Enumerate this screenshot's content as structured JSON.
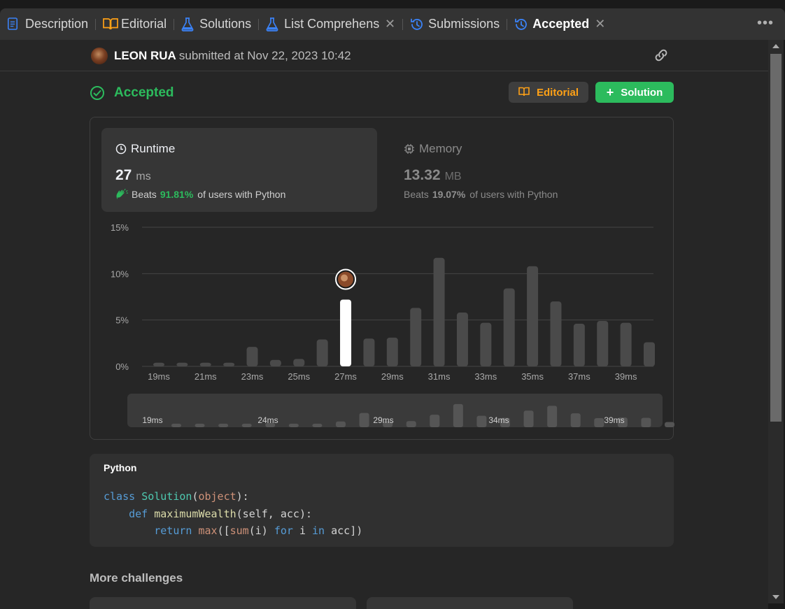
{
  "tabs": [
    {
      "label": "Description",
      "icon": "description-icon",
      "color": "#3b82f6",
      "active": false
    },
    {
      "label": "Editorial",
      "icon": "book-icon",
      "color": "#ffa116",
      "active": false
    },
    {
      "label": "Solutions",
      "icon": "flask-icon",
      "color": "#3b82f6",
      "active": false
    },
    {
      "label": "List Comprehension",
      "icon": "flask-icon",
      "color": "#3b82f6",
      "active": false,
      "closable": true
    },
    {
      "label": "Submissions",
      "icon": "history-icon",
      "color": "#3b82f6",
      "active": false
    },
    {
      "label": "Accepted",
      "icon": "history-icon",
      "color": "#3b82f6",
      "active": true,
      "closable": true
    }
  ],
  "submission": {
    "user": "LEON RUA",
    "submitted_text": "submitted at Nov 22, 2023 10:42"
  },
  "status": {
    "label": "Accepted",
    "color": "#2cbb5d"
  },
  "buttons": {
    "editorial": "Editorial",
    "solution": "Solution"
  },
  "runtime": {
    "title": "Runtime",
    "value": "27",
    "unit": "ms",
    "beats_label": "Beats",
    "beats_pct": "91.81%",
    "beats_suffix": "of users with Python"
  },
  "memory": {
    "title": "Memory",
    "value": "13.32",
    "unit": "MB",
    "beats_label": "Beats",
    "beats_pct": "19.07%",
    "beats_suffix": "of users with Python"
  },
  "chart_data": {
    "type": "bar",
    "y_ticks": [
      "15%",
      "10%",
      "5%",
      "0%"
    ],
    "ylim": [
      0,
      15
    ],
    "x": [
      19,
      20,
      21,
      22,
      23,
      24,
      25,
      26,
      27,
      28,
      29,
      30,
      31,
      32,
      33,
      34,
      35,
      36,
      37,
      38,
      39,
      40
    ],
    "x_tick_labels": [
      "19ms",
      "21ms",
      "23ms",
      "25ms",
      "27ms",
      "29ms",
      "31ms",
      "33ms",
      "35ms",
      "37ms",
      "39ms"
    ],
    "values": [
      0.4,
      0.4,
      0.4,
      0.4,
      2.1,
      0.7,
      0.8,
      2.9,
      7.2,
      3.0,
      3.1,
      6.3,
      11.7,
      5.8,
      4.7,
      8.4,
      10.8,
      7.0,
      4.6,
      4.9,
      4.7,
      2.6
    ],
    "highlight_x": 27,
    "grid": true,
    "overview_labels": [
      "19ms",
      "24ms",
      "29ms",
      "34ms",
      "39ms"
    ]
  },
  "code": {
    "language": "Python",
    "lines": [
      [
        {
          "t": "class ",
          "c": "kw"
        },
        {
          "t": "Solution",
          "c": "cls"
        },
        {
          "t": "(",
          "c": "pl"
        },
        {
          "t": "object",
          "c": "bi2"
        },
        {
          "t": "):",
          "c": "pl"
        }
      ],
      [
        {
          "t": "    ",
          "c": "pl"
        },
        {
          "t": "def ",
          "c": "kw"
        },
        {
          "t": "maximumWealth",
          "c": "fn"
        },
        {
          "t": "(self, acc):",
          "c": "pl"
        }
      ],
      [
        {
          "t": "        ",
          "c": "pl"
        },
        {
          "t": "return ",
          "c": "kw"
        },
        {
          "t": "max",
          "c": "bi2"
        },
        {
          "t": "([",
          "c": "pl"
        },
        {
          "t": "sum",
          "c": "bi2"
        },
        {
          "t": "(i) ",
          "c": "pl"
        },
        {
          "t": "for ",
          "c": "kw"
        },
        {
          "t": "i ",
          "c": "pl"
        },
        {
          "t": "in ",
          "c": "kw"
        },
        {
          "t": "acc])",
          "c": "pl"
        }
      ]
    ]
  },
  "more_challenges": "More challenges",
  "colors": {
    "accent_green": "#2cbb5d",
    "accent_orange": "#ffa116",
    "tab_blue": "#3b82f6"
  }
}
